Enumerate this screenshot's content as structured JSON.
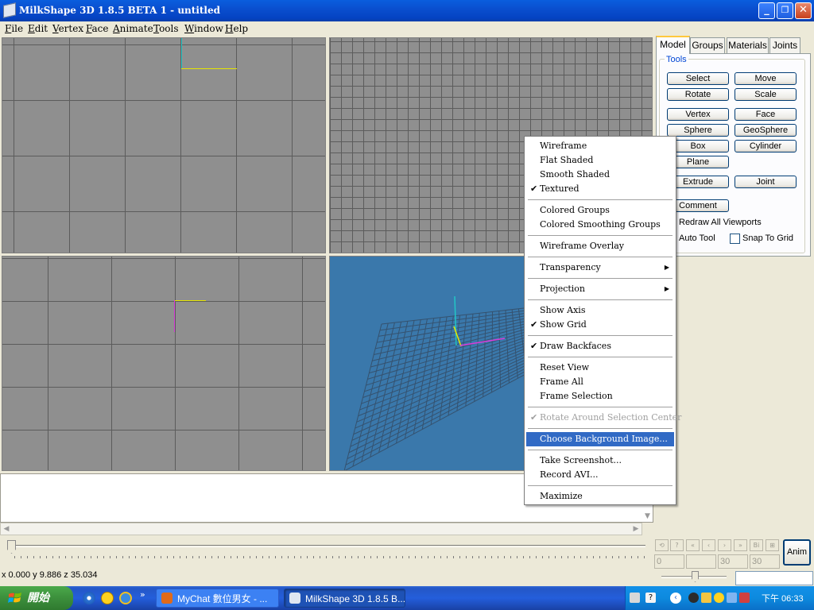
{
  "window": {
    "title": "MilkShape 3D 1.8.5 BETA 1 - untitled",
    "minimize": "_",
    "maximize": "❐",
    "close": "✕"
  },
  "menubar": [
    "File",
    "Edit",
    "Vertex",
    "Face",
    "Animate",
    "Tools",
    "Window",
    "Help"
  ],
  "tabs": [
    "Model",
    "Groups",
    "Materials",
    "Joints"
  ],
  "tools": {
    "legend": "Tools",
    "select": "Select",
    "move": "Move",
    "rotate": "Rotate",
    "scale": "Scale",
    "vertex": "Vertex",
    "face": "Face",
    "sphere": "Sphere",
    "geosphere": "GeoSphere",
    "box": "Box",
    "cylinder": "Cylinder",
    "plane": "Plane",
    "extrude": "Extrude",
    "joint": "Joint",
    "comment": "Comment",
    "redraw_all": "Redraw All Viewports",
    "auto_tool": "Auto Tool",
    "snap_to_grid": "Snap To Grid"
  },
  "context_menu": {
    "wireframe": "Wireframe",
    "flat_shaded": "Flat Shaded",
    "smooth_shaded": "Smooth Shaded",
    "textured": "Textured",
    "colored_groups": "Colored Groups",
    "colored_smoothing_groups": "Colored Smoothing Groups",
    "wireframe_overlay": "Wireframe Overlay",
    "transparency": "Transparency",
    "projection": "Projection",
    "show_axis": "Show Axis",
    "show_grid": "Show Grid",
    "draw_backfaces": "Draw Backfaces",
    "reset_view": "Reset View",
    "frame_all": "Frame All",
    "frame_selection": "Frame Selection",
    "rotate_around_selection_center": "Rotate Around Selection Center",
    "choose_background_image": "Choose Background Image...",
    "take_screenshot": "Take Screenshot...",
    "record_avi": "Record AVI...",
    "maximize": "Maximize",
    "check": "✔",
    "arrow": "▶",
    "checked": [
      "textured",
      "show_grid",
      "draw_backfaces",
      "rotate_around_selection_center"
    ],
    "highlighted": "choose_background_image"
  },
  "status": {
    "coords": "x 0.000 y 9.886 z 35.034"
  },
  "animation": {
    "buttons": [
      "⟲",
      "?",
      "«",
      "‹",
      "›",
      "»",
      "Bi",
      "⊞"
    ],
    "current_frame": "0",
    "start_frame": "30",
    "end_frame": "30",
    "anim_label": "Anim"
  },
  "taskbar": {
    "start_label": "開始",
    "quick_launch_more": "»",
    "task_mychat": "MyChat 數位男女 - ...",
    "task_milkshape": "MilkShape 3D 1.8.5 B...",
    "tray_expand": "‹",
    "clock": "下午 06:33"
  },
  "colors": {
    "titlebar_blue": "#0a4fcf",
    "viewport_grey": "#8f8f8f",
    "viewport_3d_blue": "#3a78ab",
    "menu_highlight": "#316ac5",
    "axis_x": "#d93cd9",
    "axis_y": "#e6e600",
    "axis_z": "#22c6c6"
  }
}
